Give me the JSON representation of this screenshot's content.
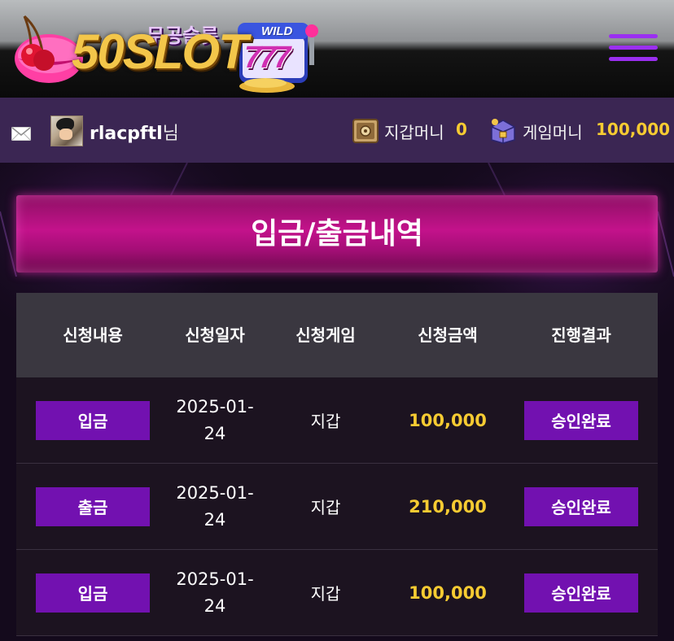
{
  "header": {
    "logo_number_text": "50SLOT",
    "logo_korean_text": "무공슬롯",
    "logo_wild_text": "WILD",
    "logo_777_text": "777",
    "menu_icon": "hamburger-menu-icon"
  },
  "userbar": {
    "mail_icon": "mail-icon",
    "username": "rlacpftl",
    "username_suffix": "님",
    "wallet_label": "지갑머니",
    "wallet_value": "0",
    "game_label": "게임머니",
    "game_value": "100,000"
  },
  "page": {
    "title": "입금/출금내역"
  },
  "table": {
    "headers": {
      "type": "신청내용",
      "date": "신청일자",
      "game": "신청게임",
      "amount": "신청금액",
      "result": "진행결과"
    },
    "rows": [
      {
        "type": "입금",
        "date": "2025-01-24",
        "game": "지갑",
        "amount": "100,000",
        "result": "승인완료"
      },
      {
        "type": "출금",
        "date": "2025-01-24",
        "game": "지갑",
        "amount": "210,000",
        "result": "승인완료"
      },
      {
        "type": "입금",
        "date": "2025-01-24",
        "game": "지갑",
        "amount": "100,000",
        "result": "승인완료"
      }
    ]
  },
  "colors": {
    "accent_purple": "#7211b0",
    "title_magenta": "#c3128b",
    "amount_gold": "#f6cb32",
    "userbar_bg": "#3b2653"
  }
}
